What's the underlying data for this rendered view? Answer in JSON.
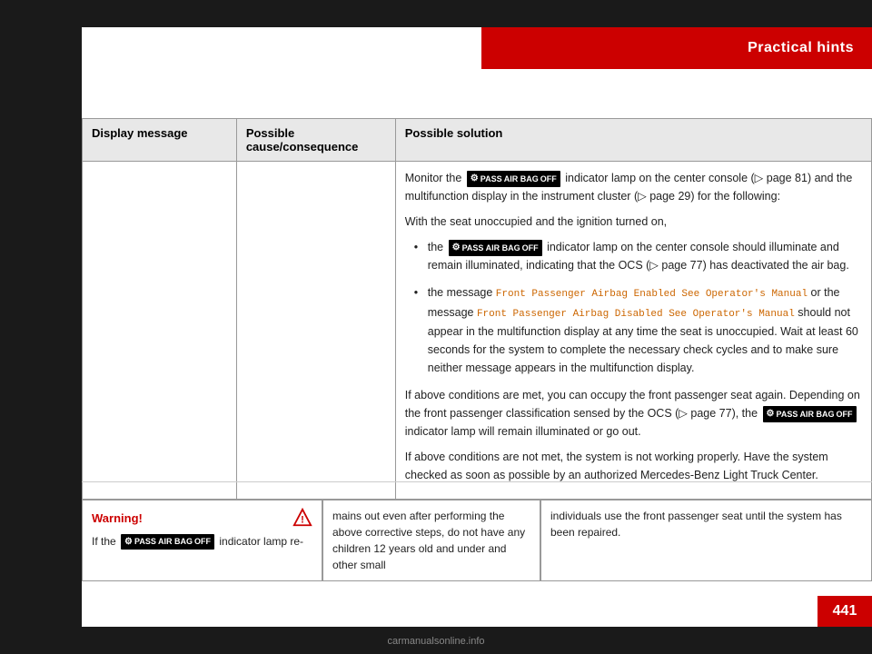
{
  "header": {
    "title": "Practical hints",
    "background": "#cc0000"
  },
  "table": {
    "columns": [
      "Display message",
      "Possible cause/consequence",
      "Possible solution"
    ],
    "rows": [
      {
        "display_message": "",
        "cause": "",
        "solution_paragraphs": [
          "Monitor the  indicator lamp on the center console (▷ page 81) and the multifunction display in the instrument cluster (▷ page 29) for the following:",
          "With the seat unoccupied and the ignition turned on,",
          "the  indicator lamp on the center console should illuminate and remain illuminated, indicating that the OCS (▷ page 77) has deactivated the air bag.",
          "the message Front Passenger Airbag Enabled See Operator's Manual or the message Front Passenger Airbag Disabled See Operator's Manual should not appear in the multifunction display at any time the seat is unoccupied. Wait at least 60 seconds for the system to complete the necessary check cycles and to make sure neither message appears in the multifunction display.",
          "If above conditions are met, you can occupy the front passenger seat again. Depending on the front passenger classification sensed by the OCS (▷ page 77), the  indicator lamp will remain illuminated or go out.",
          "If above conditions are not met, the system is not working properly. Have the system checked as soon as possible by an authorized Mercedes-Benz Light Truck Center."
        ]
      }
    ]
  },
  "warning_section": {
    "label": "Warning!",
    "triangle_symbol": "⚠",
    "warning_text": "If the  indicator lamp re-"
  },
  "middle_text": "mains out even after performing the above corrective steps, do not have any children 12 years old and under and other small",
  "right_text": "individuals use the front passenger seat until the system has been repaired.",
  "page_number": "441",
  "watermark": "carmanualsonline.info"
}
